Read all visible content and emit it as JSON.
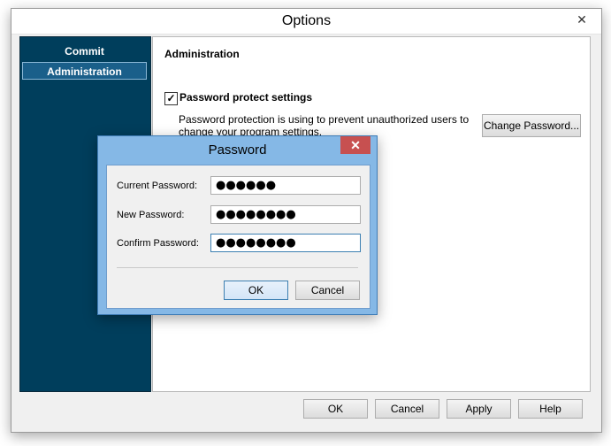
{
  "window": {
    "title": "Options",
    "close_glyph": "✕"
  },
  "sidebar": {
    "items": [
      {
        "label": "Commit",
        "selected": false
      },
      {
        "label": "Administration",
        "selected": true
      }
    ]
  },
  "content": {
    "section_title": "Administration",
    "password_protect": {
      "label": "Password protect settings",
      "checked": true,
      "check_glyph": "✓"
    },
    "description": "Password protection is using to prevent unauthorized users to change your program settings.",
    "change_password_button": "Change Password..."
  },
  "footer": {
    "ok": "OK",
    "cancel": "Cancel",
    "apply": "Apply",
    "help": "Help"
  },
  "password_dialog": {
    "title": "Password",
    "close_glyph": "✕",
    "fields": [
      {
        "label": "Current Password:",
        "value": "●●●●●●"
      },
      {
        "label": "New Password:",
        "value": "●●●●●●●●"
      },
      {
        "label": "Confirm Password:",
        "value": "●●●●●●●●"
      }
    ],
    "ok": "OK",
    "cancel": "Cancel"
  },
  "colors": {
    "sidebar_bg": "#003e5c",
    "sidebar_selected": "#1a5f8a",
    "dialog_frame": "#85b8e6",
    "dialog_close": "#c75050"
  }
}
